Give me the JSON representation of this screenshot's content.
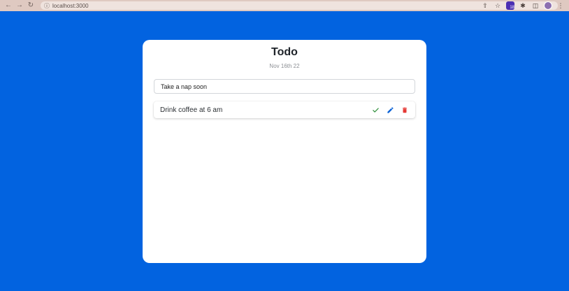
{
  "browser": {
    "url": "localhost:3000",
    "ext_badge": "18"
  },
  "app": {
    "title": "Todo",
    "date": "Nov 16th 22",
    "input_value": "Take a nap soon"
  },
  "todos": [
    {
      "text": "Drink coffee at 6 am",
      "actions": [
        "check-icon",
        "pencil-icon",
        "trash-icon"
      ]
    }
  ],
  "colors": {
    "background": "#0263e0",
    "check": "#2f8f3b",
    "edit": "#0b62d6",
    "delete": "#e53935"
  }
}
